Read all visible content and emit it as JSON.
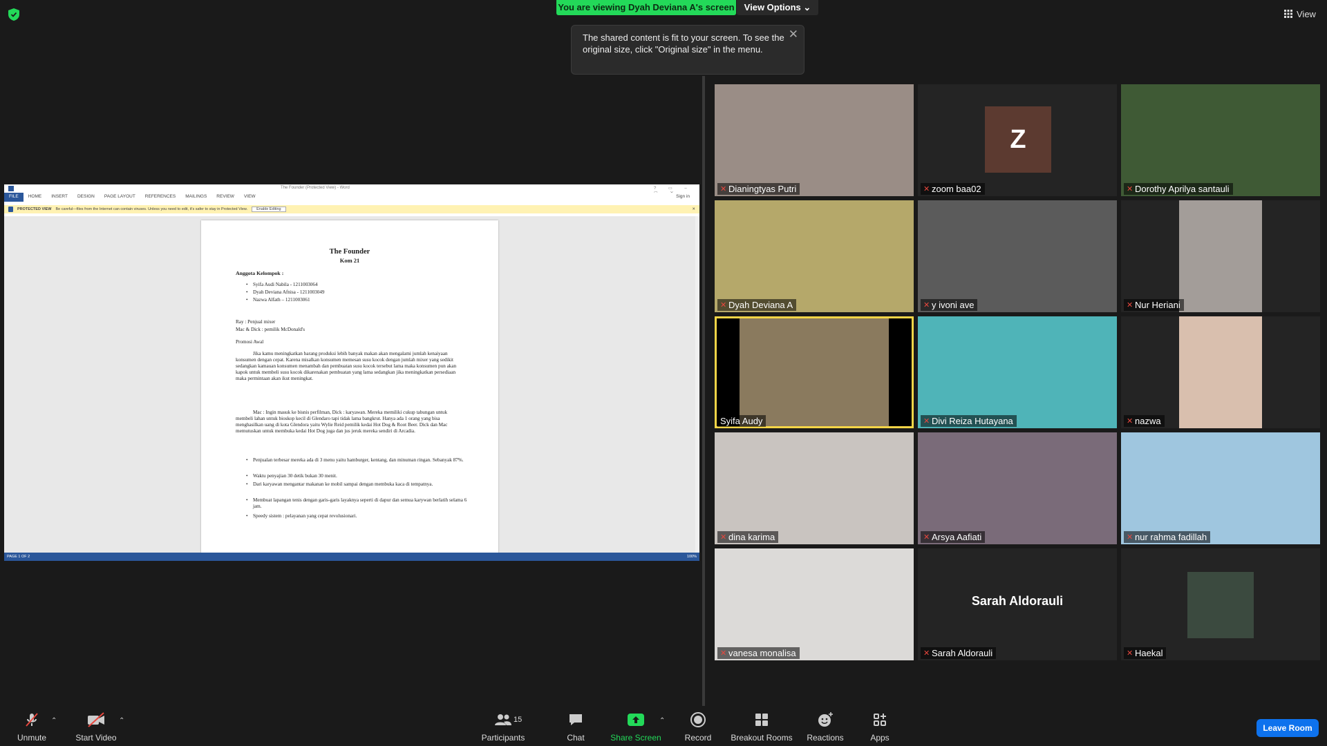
{
  "top": {
    "banner": "You are viewing Dyah Deviana A's screen",
    "view_options": "View Options",
    "view": "View",
    "tooltip": "The shared content is fit to your screen. To see the original size, click \"Original size\" in the menu."
  },
  "word": {
    "window_title": "The Founder (Protected View) - Word",
    "sign_in": "Sign in",
    "ribbon_tabs": [
      "FILE",
      "HOME",
      "INSERT",
      "DESIGN",
      "PAGE LAYOUT",
      "REFERENCES",
      "MAILINGS",
      "REVIEW",
      "VIEW"
    ],
    "protected_label": "PROTECTED VIEW",
    "protected_text": "Be careful—files from the Internet can contain viruses. Unless you need to edit, it's safer to stay in Protected View.",
    "enable_editing": "Enable Editing",
    "status_page": "PAGE 1 OF 2",
    "zoom": "100%",
    "doc": {
      "title": "The Founder",
      "subtitle": "Kom 21",
      "members_heading": "Anggota Kelompok :",
      "members": [
        "Syifa Audi Nabila - 1211003064",
        "Dyah Deviana Afnisa - 1211003049",
        "Nazwa Alfath – 1211003061"
      ],
      "line1": "Ray : Penjual mixer",
      "line2": "Mac & Dick : pemilik McDonald's",
      "line3": "Promosi Awal",
      "para1": "Jika kamu meningkatkan barang produksi lebih banyak makan akan mengalami jumlah kenaiyaan konsumen dengan cepat. Karena misalkan konsumen memesan susu kocok dengan jumlah mixer yang sedikit sedangkan kamauan konsumen menambah dan pembuatan susu kocok tersebut lama maka konsumen pun akan kapok untuk membeli susu kocok dikarenakan pembuatan yang lama sedangkan jika meningkatkan persediaan maka permintaan akan ikut meningkat.",
      "para2": "Mac : Ingin masuk ke bisnis perfilman, Dick : karyawan. Mereka memiliki cukup tabungan untuk membeli lahan untuk bioskop kecil di Glendaro tapi tidak lama bangkrut. Hanya ada 1 orang yang bisa menghasilkan uang di kota Glendora yaitu Wylie Reid pemilik kedai Hot Dog & Root Beer. Dick dan Mac memutuskan untuk membuka kedai Hot Dog juga dan jus jeruk mereka sendiri di Arcadia.",
      "bullets": [
        "Penjualan terbesar mereka ada di 3 menu yaitu hamburger, kentang, dan minuman ringan. Sebanyak 87%.",
        "Waktu penyajian 30 detik bukan 30 menit.",
        "Dari karyawan mengantar makanan ke mobil sampai dengan membuka kaca di tempatnya.",
        "Membuat lapangan tenis dengan garis-garis layaknya seperti di dapur dan semua karywan berlatih selama 6 jam.",
        "Speedy sistem : pelayanan yang cepat revolusionari."
      ]
    }
  },
  "gallery": [
    {
      "name": "Dianingtyas Putri"
    },
    {
      "name": "zoom baa02",
      "initial": "Z"
    },
    {
      "name": "Dorothy Aprilya santauli"
    },
    {
      "name": "Dyah Deviana A"
    },
    {
      "name": "y ivoni ave"
    },
    {
      "name": "Nur Heriani"
    },
    {
      "name": "Syifa Audy"
    },
    {
      "name": "Divi Reiza Hutayana"
    },
    {
      "name": "nazwa"
    },
    {
      "name": "dina karima"
    },
    {
      "name": "Arsya Aafiati"
    },
    {
      "name": "nur rahma fadillah"
    },
    {
      "name": "vanesa monalisa"
    },
    {
      "name": "Sarah Aldorauli",
      "big_name": "Sarah Aldorauli"
    },
    {
      "name": "Haekal"
    }
  ],
  "toolbar": {
    "unmute": "Unmute",
    "start_video": "Start Video",
    "participants": "Participants",
    "participants_count": "15",
    "chat": "Chat",
    "share_screen": "Share Screen",
    "record": "Record",
    "breakout_rooms": "Breakout Rooms",
    "reactions": "Reactions",
    "apps": "Apps",
    "leave_room": "Leave Room"
  },
  "colors": {
    "accent_green": "#23d959",
    "leave_blue": "#0e72ed",
    "active_speaker": "#f5d547",
    "muted_red": "#e8473e"
  }
}
